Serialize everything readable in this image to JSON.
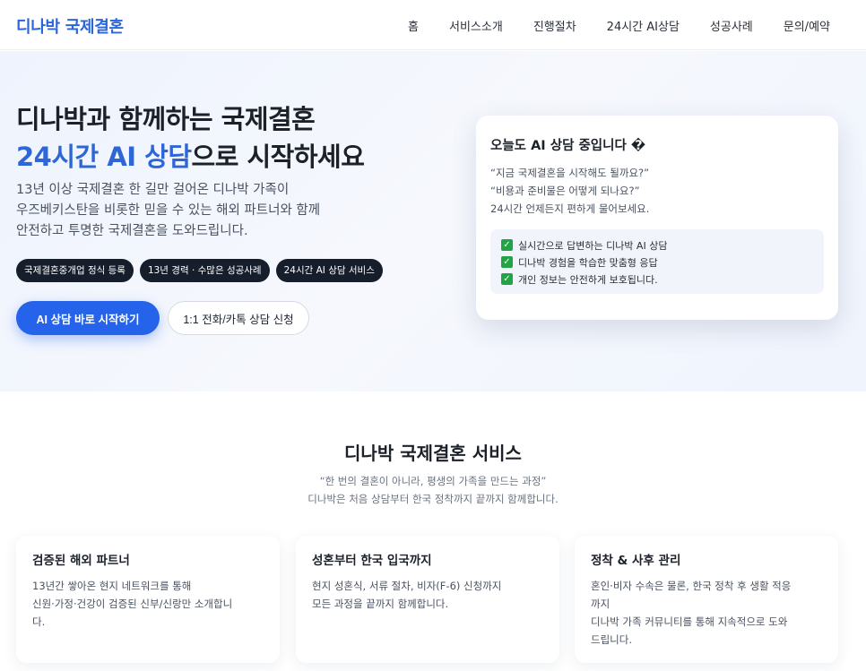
{
  "nav": {
    "logo": "디나박 국제결혼",
    "items": [
      "홈",
      "서비스소개",
      "진행절차",
      "24시간 AI상담",
      "성공사례",
      "문의/예약"
    ]
  },
  "hero": {
    "title_line1": "디나박과 함께하는 국제결혼",
    "title_accent": "24시간 AI 상담",
    "title_rest": "으로 시작하세요",
    "desc": [
      "13년 이상 국제결혼 한 길만 걸어온 디나박 가족이",
      "우즈베키스탄을 비롯한 믿을 수 있는 해외 파트너와 함께",
      "안전하고 투명한 국제결혼을 도와드립니다."
    ],
    "pills": [
      "국제결혼중개업 정식 등록",
      "13년 경력 · 수많은 성공사례",
      "24시간 AI 상담 서비스"
    ],
    "primary_button": "AI 상담 바로 시작하기",
    "secondary_button": "1:1 전화/카톡 상담 신청"
  },
  "ai_card": {
    "title": "오늘도 AI 상담 중입니다 �",
    "questions": [
      "“지금 국제결혼을 시작해도 될까요?”",
      "“비용과 준비물은 어떻게 되나요?”",
      "24시간 언제든지 편하게 물어보세요."
    ],
    "checks": [
      "실시간으로 답변하는 디나박 AI 상담",
      "디나박 경험을 학습한 맞춤형 응답",
      "개인 정보는 안전하게 보호됩니다."
    ]
  },
  "services": {
    "title": "디나박 국제결혼 서비스",
    "subtitle_line1": "“한 번의 결혼이 아니라, 평생의 가족을 만드는 과정”",
    "subtitle_line2": "디나박은 처음 상담부터 한국 정착까지 끝까지 함께합니다.",
    "cards": [
      {
        "title": "검증된 해외 파트너",
        "lines": [
          "13년간 쌓아온 현지 네트워크를 통해",
          "신원·가정·건강이 검증된 신부/신랑만 소개합니",
          "다."
        ]
      },
      {
        "title": "성혼부터 한국 입국까지",
        "lines": [
          "현지 성혼식, 서류 절차, 비자(F-6) 신청까지",
          "모든 과정을 끝까지 함께합니다."
        ]
      },
      {
        "title": "정착 & 사후 관리",
        "lines": [
          "혼인·비자 수속은 물론, 한국 정착 후 생활 적응",
          "까지",
          "디나박 가족 커뮤니티를 통해 지속적으로 도와",
          "드립니다."
        ]
      }
    ]
  },
  "colors": {
    "accent": "#2563eb",
    "pill_bg": "#161d2b",
    "check_green": "#22a345"
  }
}
